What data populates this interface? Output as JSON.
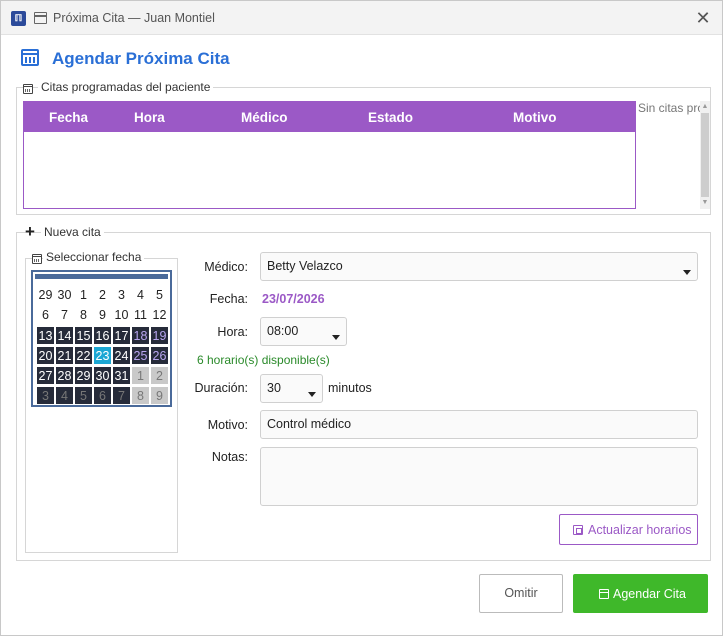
{
  "window": {
    "title": "Próxima Cita — Juan Montiel",
    "app_logo": "ℿ"
  },
  "dialog": {
    "heading": "Agendar Próxima Cita"
  },
  "scheduled": {
    "group_label": "Citas programadas del paciente",
    "columns": [
      "Fecha",
      "Hora",
      "Médico",
      "Estado",
      "Motivo"
    ],
    "rows": [],
    "empty_text": "Sin citas programadas"
  },
  "new_appt": {
    "group_label": "Nueva cita",
    "calendar_label": "Seleccionar fecha",
    "calendar": {
      "weeks": [
        [
          "29",
          "30",
          "1",
          "2",
          "3",
          "4",
          "5"
        ],
        [
          "6",
          "7",
          "8",
          "9",
          "10",
          "11",
          "12"
        ],
        [
          "13",
          "14",
          "15",
          "16",
          "17",
          "18",
          "19"
        ],
        [
          "20",
          "21",
          "22",
          "23",
          "24",
          "25",
          "26"
        ],
        [
          "27",
          "28",
          "29",
          "30",
          "31",
          "1",
          "2"
        ],
        [
          "3",
          "4",
          "5",
          "6",
          "7",
          "8",
          "9"
        ]
      ],
      "selected_day": "23"
    },
    "doctor_label": "Médico:",
    "doctor_value": "Betty Velazco",
    "date_label": "Fecha:",
    "date_value": "23/07/2026",
    "time_label": "Hora:",
    "time_value": "08:00",
    "availability_text": "6 horario(s) disponible(s)",
    "duration_label": "Duración:",
    "duration_value": "30",
    "duration_unit": "minutos",
    "reason_label": "Motivo:",
    "reason_value": "Control médico",
    "notes_label": "Notas:",
    "notes_value": "",
    "refresh_label": "Actualizar horarios"
  },
  "footer": {
    "cancel_label": "Omitir",
    "submit_label": "Agendar Cita"
  },
  "colors": {
    "accent_blue": "#2a6fd6",
    "accent_purple": "#9b59c6",
    "success_green": "#3fb82a",
    "calendar_dark": "#262b3a",
    "calendar_selected": "#1ba7d4"
  }
}
